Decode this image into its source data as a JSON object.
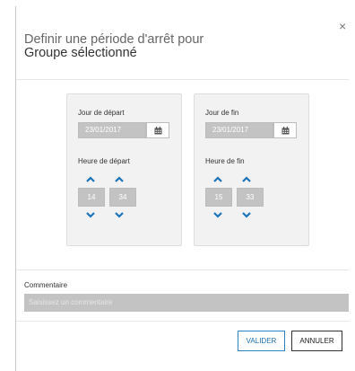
{
  "dialog": {
    "title_line1": "Definir une période d'arrêt pour",
    "title_line2": "Groupe sélectionné",
    "close_symbol": "×"
  },
  "start": {
    "date_label": "Jour de départ",
    "date_value": "23/01/2017",
    "time_label": "Heure de départ",
    "hour": "14",
    "minute": "34",
    "separator": ":"
  },
  "end": {
    "date_label": "Jour de fin",
    "date_value": "23/01/2017",
    "time_label": "Heure de fin",
    "hour": "15",
    "minute": "33",
    "separator": ":"
  },
  "comment": {
    "label": "Commentaire",
    "placeholder": "Saisissez un commentaire"
  },
  "buttons": {
    "validate": "VALIDER",
    "cancel": "ANNULER"
  },
  "colors": {
    "accent": "#2a84c6",
    "disabled_field": "#c3c3c3",
    "panel_bg": "#f2f2f2"
  },
  "icons": [
    "close-icon",
    "calendar-icon",
    "chevron-up-icon",
    "chevron-down-icon"
  ]
}
